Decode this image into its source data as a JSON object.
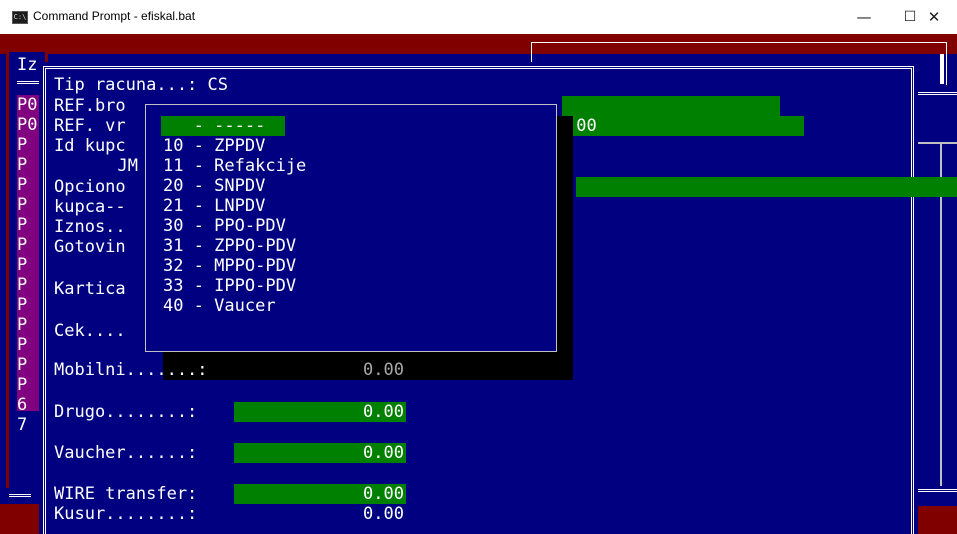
{
  "window": {
    "title": "Command Prompt - efiskal.bat",
    "icon_text": "C:\\",
    "minimize_glyph": "—",
    "maximize_glyph": "☐",
    "close_glyph": "✕"
  },
  "background": {
    "iz_label": "Iz",
    "left_letters": [
      "P0",
      "P0",
      "P",
      "P",
      "P",
      "P",
      "P",
      "P",
      "P",
      "P",
      "P",
      "P",
      "P",
      "P",
      "P",
      "6",
      "7"
    ]
  },
  "form": {
    "tip_racuna": "Tip racuna...: CS",
    "ref_broj": "REF.bro",
    "ref_vr": "REF. vr",
    "ref_vr_value": ":00",
    "id_kupca": "Id kupc",
    "jm": "JM",
    "opciono": "Opciono",
    "kupca": "kupca--",
    "iznos": "Iznos..",
    "gotovina": "Gotovin",
    "kartica": "Kartica",
    "cek": "Cek....",
    "mobilni": "Mobilni.......:",
    "mobilni_value": "0.00",
    "drugo": "Drugo........:",
    "drugo_value": "0.00",
    "vaucher": "Vaucher......:",
    "vaucher_value": "0.00",
    "wire": "WIRE transfer:",
    "wire_value": "0.00",
    "kusur": "Kusur........:",
    "kusur_value": "0.00"
  },
  "popup": {
    "items": [
      "   - -----",
      "10 - ZPPDV",
      "11 - Refakcije",
      "20 - SNPDV",
      "21 - LNPDV",
      "30 - PPO-PDV",
      "31 - ZPPO-PDV",
      "32 - MPPO-PDV",
      "33 - IPPO-PDV",
      "40 - Vaucer"
    ],
    "selected_index": 0
  },
  "colors": {
    "console_bg": "#000080",
    "field_green": "#008000",
    "frame_maroon": "#800000"
  }
}
